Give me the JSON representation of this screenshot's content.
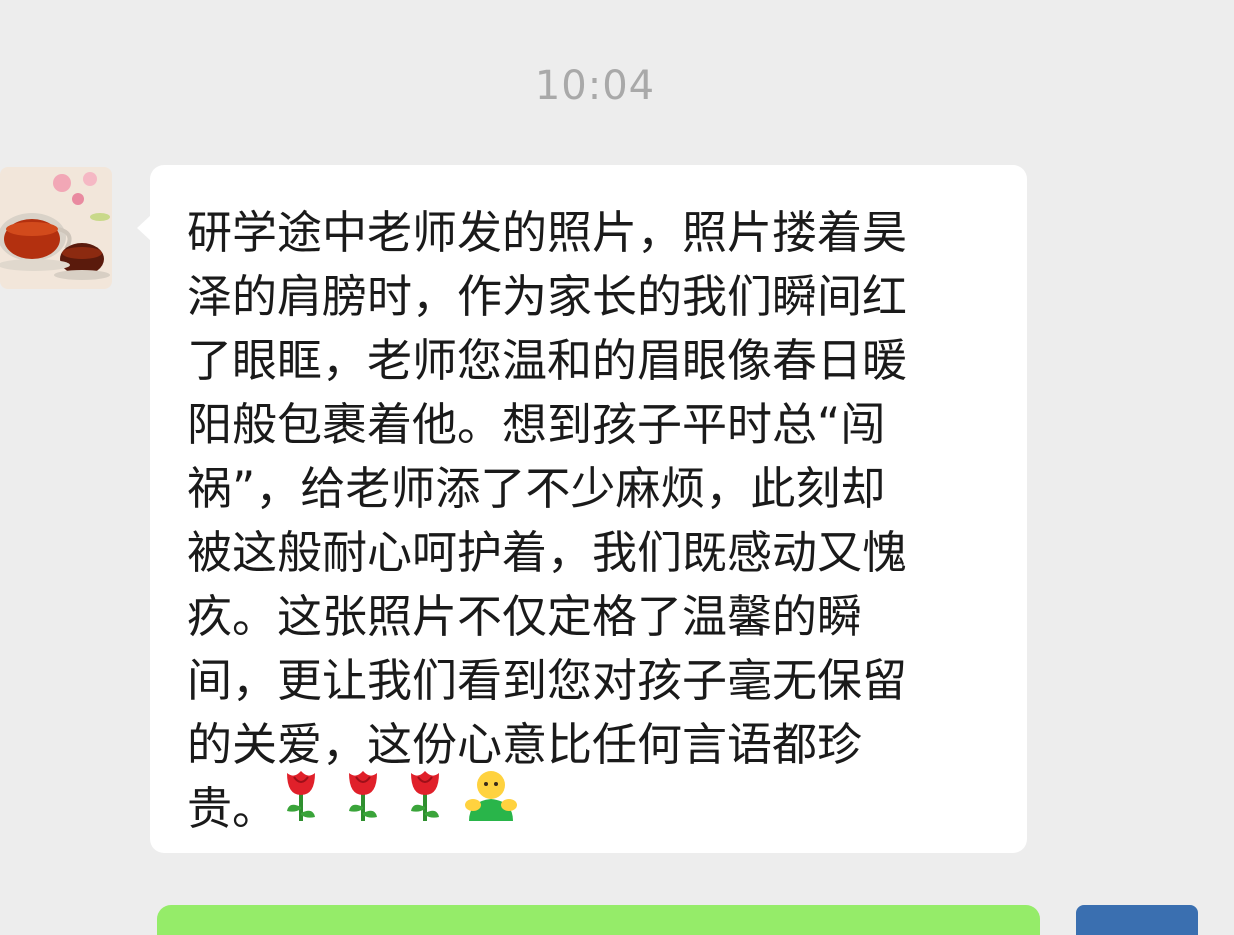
{
  "chat": {
    "timestamp": "10:04",
    "messages": [
      {
        "sender": "contact",
        "avatar_icon": "tea-cup-avatar-icon",
        "text": "研学途中老师发的照片，照片搂着昊\n泽的肩膀时，作为家长的我们瞬间红\n了眼眶，老师您温和的眉眼像春日暖\n阳般包裹着他。想到孩子平时总“闯\n祸”，给老师添了不少麻烦，此刻却\n被这般耐心呵护着，我们既感动又愧\n疚。这张照片不仅定格了温馨的瞬\n间，更让我们看到您对孩子毫无保留\n的关爱，这份心意比任何言语都珍\n贵。",
        "emojis": [
          "rose-icon",
          "rose-icon",
          "rose-icon",
          "hug-icon"
        ]
      }
    ]
  },
  "colors": {
    "background": "#ededed",
    "incoming_bubble": "#ffffff",
    "outgoing_bubble": "#95ec69",
    "timestamp_text": "#a9a9a9"
  }
}
